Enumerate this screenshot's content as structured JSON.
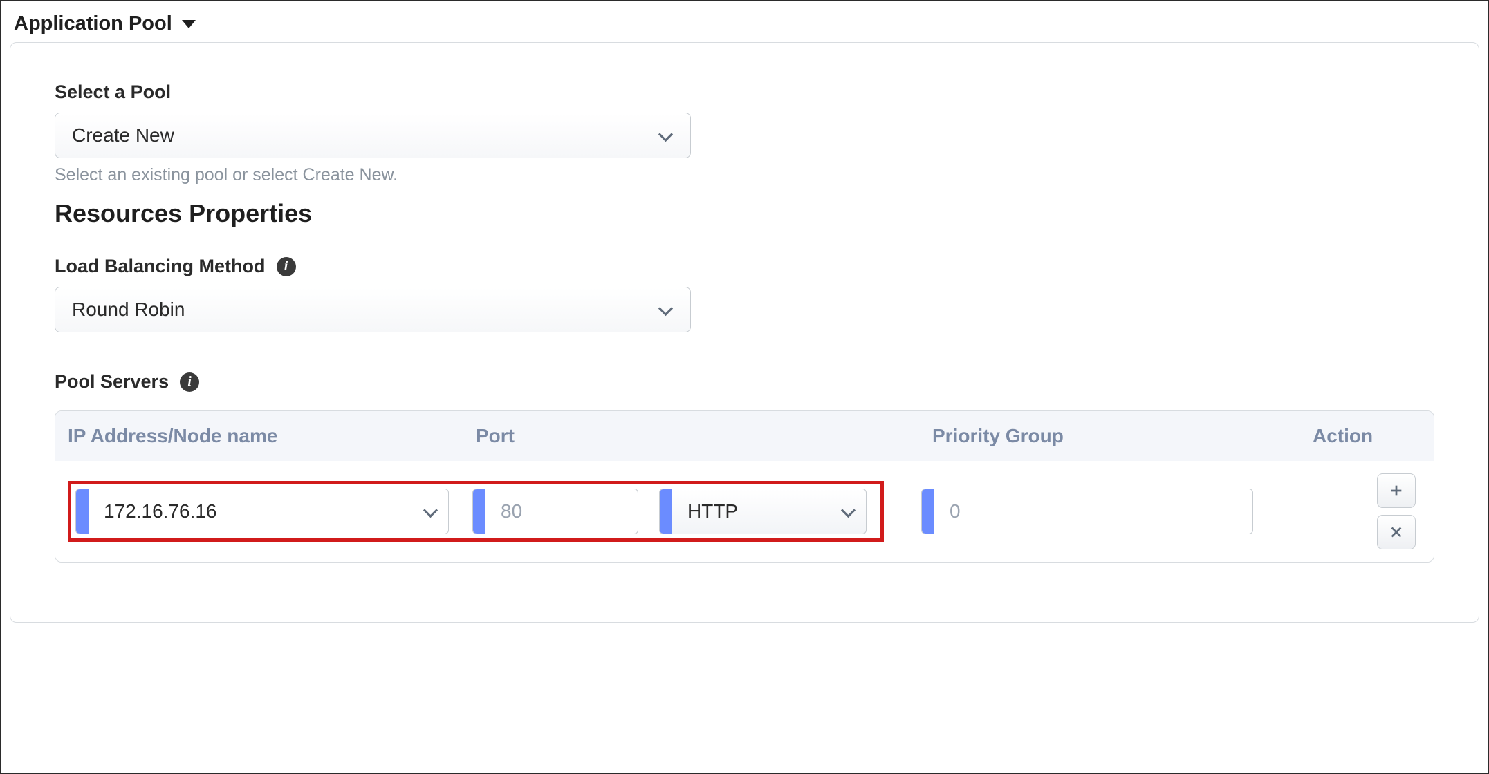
{
  "section": {
    "title": "Application Pool"
  },
  "pool": {
    "label": "Select a Pool",
    "selected": "Create New",
    "help": "Select an existing pool or select Create New."
  },
  "resources": {
    "heading": "Resources Properties",
    "lb": {
      "label": "Load Balancing Method",
      "selected": "Round Robin"
    },
    "servers": {
      "label": "Pool Servers",
      "columns": {
        "ip": "IP Address/Node name",
        "port": "Port",
        "pg": "Priority Group",
        "action": "Action"
      },
      "row": {
        "ip": "172.16.76.16",
        "port_placeholder": "80",
        "protocol": "HTTP",
        "priority_placeholder": "0"
      }
    }
  }
}
